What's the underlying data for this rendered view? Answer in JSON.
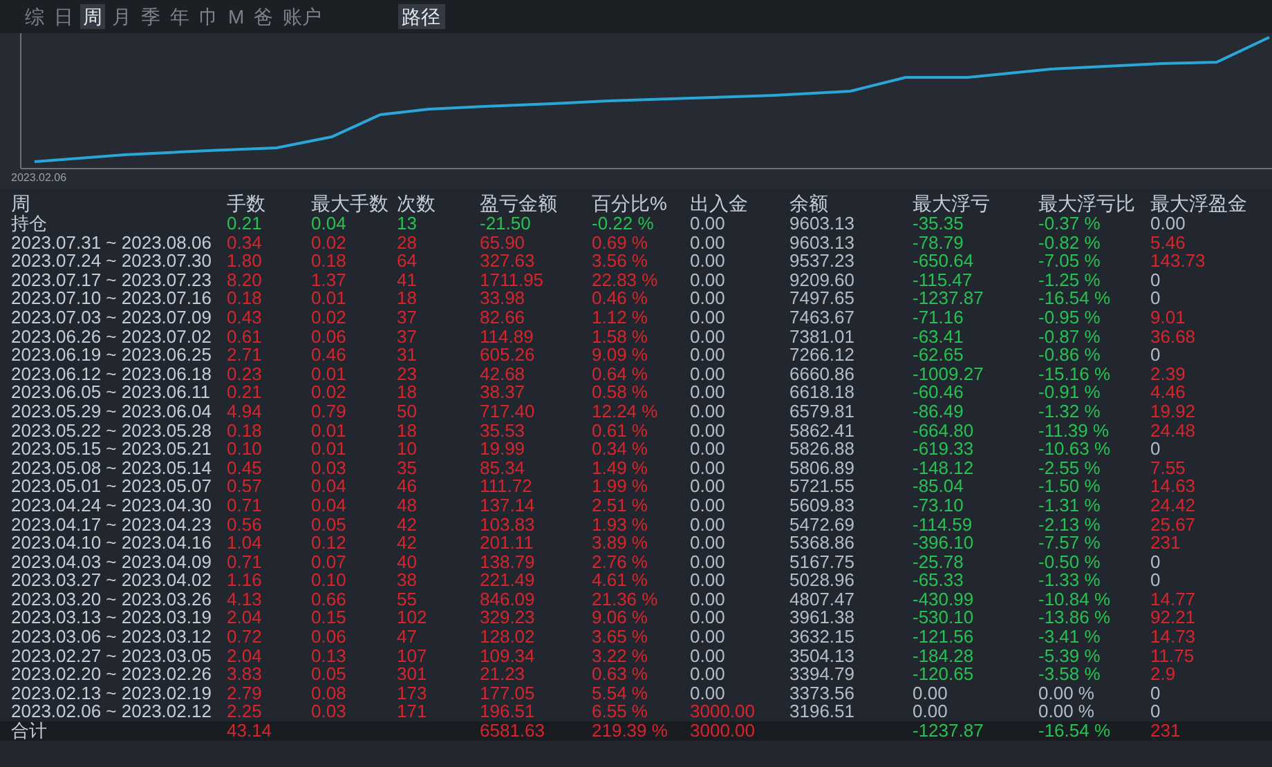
{
  "tabs": [
    {
      "label": "综",
      "selected": false
    },
    {
      "label": "日",
      "selected": false
    },
    {
      "label": "周",
      "selected": true
    },
    {
      "label": "月",
      "selected": false
    },
    {
      "label": "季",
      "selected": false
    },
    {
      "label": "年",
      "selected": false
    },
    {
      "label": "巾",
      "selected": false
    },
    {
      "label": "M",
      "selected": false
    },
    {
      "label": "爸",
      "selected": false
    },
    {
      "label": "账户",
      "selected": false
    }
  ],
  "path_button": {
    "label": "路径",
    "selected": true
  },
  "equity_chart": {
    "start_label": "2023.02.06"
  },
  "table": {
    "period_column": "周",
    "columns": [
      "手数",
      "最大手数",
      "次数",
      "盈亏金额",
      "百分比%",
      "出入金",
      "余额",
      "最大浮亏",
      "最大浮亏比",
      "最大浮盈金"
    ],
    "rows": [
      {
        "period": "持仓",
        "cells": [
          {
            "text": "0.21",
            "color": "#25c24f"
          },
          {
            "text": "0.04",
            "color": "#25c24f"
          },
          {
            "text": "13",
            "color": "#25c24f"
          },
          {
            "text": "-21.50",
            "color": "#25c24f"
          },
          {
            "text": "-0.22 %",
            "color": "#25c24f"
          },
          {
            "text": "0.00",
            "color": "#b4bcc8"
          },
          {
            "text": "9603.13",
            "color": "#b4bcc8"
          },
          {
            "text": "-35.35",
            "color": "#25c24f"
          },
          {
            "text": "-0.37 %",
            "color": "#25c24f"
          },
          {
            "text": "0.00",
            "color": "#b4bcc8"
          }
        ]
      },
      {
        "period": "2023.07.31 ~ 2023.08.06",
        "cells": [
          {
            "text": "0.34",
            "color": "#d8242a"
          },
          {
            "text": "0.02",
            "color": "#d8242a"
          },
          {
            "text": "28",
            "color": "#d8242a"
          },
          {
            "text": "65.90",
            "color": "#d8242a"
          },
          {
            "text": "0.69 %",
            "color": "#d8242a"
          },
          {
            "text": "0.00",
            "color": "#b4bcc8"
          },
          {
            "text": "9603.13",
            "color": "#b4bcc8"
          },
          {
            "text": "-78.79",
            "color": "#25c24f"
          },
          {
            "text": "-0.82 %",
            "color": "#25c24f"
          },
          {
            "text": "5.46",
            "color": "#d8242a"
          }
        ]
      },
      {
        "period": "2023.07.24 ~ 2023.07.30",
        "cells": [
          {
            "text": "1.80",
            "color": "#d8242a"
          },
          {
            "text": "0.18",
            "color": "#d8242a"
          },
          {
            "text": "64",
            "color": "#d8242a"
          },
          {
            "text": "327.63",
            "color": "#d8242a"
          },
          {
            "text": "3.56 %",
            "color": "#d8242a"
          },
          {
            "text": "0.00",
            "color": "#b4bcc8"
          },
          {
            "text": "9537.23",
            "color": "#b4bcc8"
          },
          {
            "text": "-650.64",
            "color": "#25c24f"
          },
          {
            "text": "-7.05 %",
            "color": "#25c24f"
          },
          {
            "text": "143.73",
            "color": "#d8242a"
          }
        ]
      },
      {
        "period": "2023.07.17 ~ 2023.07.23",
        "cells": [
          {
            "text": "8.20",
            "color": "#d8242a"
          },
          {
            "text": "1.37",
            "color": "#d8242a"
          },
          {
            "text": "41",
            "color": "#d8242a"
          },
          {
            "text": "1711.95",
            "color": "#d8242a"
          },
          {
            "text": "22.83 %",
            "color": "#d8242a"
          },
          {
            "text": "0.00",
            "color": "#b4bcc8"
          },
          {
            "text": "9209.60",
            "color": "#b4bcc8"
          },
          {
            "text": "-115.47",
            "color": "#25c24f"
          },
          {
            "text": "-1.25 %",
            "color": "#25c24f"
          },
          {
            "text": "0",
            "color": "#b4bcc8"
          }
        ]
      },
      {
        "period": "2023.07.10 ~ 2023.07.16",
        "cells": [
          {
            "text": "0.18",
            "color": "#d8242a"
          },
          {
            "text": "0.01",
            "color": "#d8242a"
          },
          {
            "text": "18",
            "color": "#d8242a"
          },
          {
            "text": "33.98",
            "color": "#d8242a"
          },
          {
            "text": "0.46 %",
            "color": "#d8242a"
          },
          {
            "text": "0.00",
            "color": "#b4bcc8"
          },
          {
            "text": "7497.65",
            "color": "#b4bcc8"
          },
          {
            "text": "-1237.87",
            "color": "#25c24f"
          },
          {
            "text": "-16.54 %",
            "color": "#25c24f"
          },
          {
            "text": "0",
            "color": "#b4bcc8"
          }
        ]
      },
      {
        "period": "2023.07.03 ~ 2023.07.09",
        "cells": [
          {
            "text": "0.43",
            "color": "#d8242a"
          },
          {
            "text": "0.02",
            "color": "#d8242a"
          },
          {
            "text": "37",
            "color": "#d8242a"
          },
          {
            "text": "82.66",
            "color": "#d8242a"
          },
          {
            "text": "1.12 %",
            "color": "#d8242a"
          },
          {
            "text": "0.00",
            "color": "#b4bcc8"
          },
          {
            "text": "7463.67",
            "color": "#b4bcc8"
          },
          {
            "text": "-71.16",
            "color": "#25c24f"
          },
          {
            "text": "-0.95 %",
            "color": "#25c24f"
          },
          {
            "text": "9.01",
            "color": "#d8242a"
          }
        ]
      },
      {
        "period": "2023.06.26 ~ 2023.07.02",
        "cells": [
          {
            "text": "0.61",
            "color": "#d8242a"
          },
          {
            "text": "0.06",
            "color": "#d8242a"
          },
          {
            "text": "37",
            "color": "#d8242a"
          },
          {
            "text": "114.89",
            "color": "#d8242a"
          },
          {
            "text": "1.58 %",
            "color": "#d8242a"
          },
          {
            "text": "0.00",
            "color": "#b4bcc8"
          },
          {
            "text": "7381.01",
            "color": "#b4bcc8"
          },
          {
            "text": "-63.41",
            "color": "#25c24f"
          },
          {
            "text": "-0.87 %",
            "color": "#25c24f"
          },
          {
            "text": "36.68",
            "color": "#d8242a"
          }
        ]
      },
      {
        "period": "2023.06.19 ~ 2023.06.25",
        "cells": [
          {
            "text": "2.71",
            "color": "#d8242a"
          },
          {
            "text": "0.46",
            "color": "#d8242a"
          },
          {
            "text": "31",
            "color": "#d8242a"
          },
          {
            "text": "605.26",
            "color": "#d8242a"
          },
          {
            "text": "9.09 %",
            "color": "#d8242a"
          },
          {
            "text": "0.00",
            "color": "#b4bcc8"
          },
          {
            "text": "7266.12",
            "color": "#b4bcc8"
          },
          {
            "text": "-62.65",
            "color": "#25c24f"
          },
          {
            "text": "-0.86 %",
            "color": "#25c24f"
          },
          {
            "text": "0",
            "color": "#b4bcc8"
          }
        ]
      },
      {
        "period": "2023.06.12 ~ 2023.06.18",
        "cells": [
          {
            "text": "0.23",
            "color": "#d8242a"
          },
          {
            "text": "0.01",
            "color": "#d8242a"
          },
          {
            "text": "23",
            "color": "#d8242a"
          },
          {
            "text": "42.68",
            "color": "#d8242a"
          },
          {
            "text": "0.64 %",
            "color": "#d8242a"
          },
          {
            "text": "0.00",
            "color": "#b4bcc8"
          },
          {
            "text": "6660.86",
            "color": "#b4bcc8"
          },
          {
            "text": "-1009.27",
            "color": "#25c24f"
          },
          {
            "text": "-15.16 %",
            "color": "#25c24f"
          },
          {
            "text": "2.39",
            "color": "#d8242a"
          }
        ]
      },
      {
        "period": "2023.06.05 ~ 2023.06.11",
        "cells": [
          {
            "text": "0.21",
            "color": "#d8242a"
          },
          {
            "text": "0.02",
            "color": "#d8242a"
          },
          {
            "text": "18",
            "color": "#d8242a"
          },
          {
            "text": "38.37",
            "color": "#d8242a"
          },
          {
            "text": "0.58 %",
            "color": "#d8242a"
          },
          {
            "text": "0.00",
            "color": "#b4bcc8"
          },
          {
            "text": "6618.18",
            "color": "#b4bcc8"
          },
          {
            "text": "-60.46",
            "color": "#25c24f"
          },
          {
            "text": "-0.91 %",
            "color": "#25c24f"
          },
          {
            "text": "4.46",
            "color": "#d8242a"
          }
        ]
      },
      {
        "period": "2023.05.29 ~ 2023.06.04",
        "cells": [
          {
            "text": "4.94",
            "color": "#d8242a"
          },
          {
            "text": "0.79",
            "color": "#d8242a"
          },
          {
            "text": "50",
            "color": "#d8242a"
          },
          {
            "text": "717.40",
            "color": "#d8242a"
          },
          {
            "text": "12.24 %",
            "color": "#d8242a"
          },
          {
            "text": "0.00",
            "color": "#b4bcc8"
          },
          {
            "text": "6579.81",
            "color": "#b4bcc8"
          },
          {
            "text": "-86.49",
            "color": "#25c24f"
          },
          {
            "text": "-1.32 %",
            "color": "#25c24f"
          },
          {
            "text": "19.92",
            "color": "#d8242a"
          }
        ]
      },
      {
        "period": "2023.05.22 ~ 2023.05.28",
        "cells": [
          {
            "text": "0.18",
            "color": "#d8242a"
          },
          {
            "text": "0.01",
            "color": "#d8242a"
          },
          {
            "text": "18",
            "color": "#d8242a"
          },
          {
            "text": "35.53",
            "color": "#d8242a"
          },
          {
            "text": "0.61 %",
            "color": "#d8242a"
          },
          {
            "text": "0.00",
            "color": "#b4bcc8"
          },
          {
            "text": "5862.41",
            "color": "#b4bcc8"
          },
          {
            "text": "-664.80",
            "color": "#25c24f"
          },
          {
            "text": "-11.39 %",
            "color": "#25c24f"
          },
          {
            "text": "24.48",
            "color": "#d8242a"
          }
        ]
      },
      {
        "period": "2023.05.15 ~ 2023.05.21",
        "cells": [
          {
            "text": "0.10",
            "color": "#d8242a"
          },
          {
            "text": "0.01",
            "color": "#d8242a"
          },
          {
            "text": "10",
            "color": "#d8242a"
          },
          {
            "text": "19.99",
            "color": "#d8242a"
          },
          {
            "text": "0.34 %",
            "color": "#d8242a"
          },
          {
            "text": "0.00",
            "color": "#b4bcc8"
          },
          {
            "text": "5826.88",
            "color": "#b4bcc8"
          },
          {
            "text": "-619.33",
            "color": "#25c24f"
          },
          {
            "text": "-10.63 %",
            "color": "#25c24f"
          },
          {
            "text": "0",
            "color": "#b4bcc8"
          }
        ]
      },
      {
        "period": "2023.05.08 ~ 2023.05.14",
        "cells": [
          {
            "text": "0.45",
            "color": "#d8242a"
          },
          {
            "text": "0.03",
            "color": "#d8242a"
          },
          {
            "text": "35",
            "color": "#d8242a"
          },
          {
            "text": "85.34",
            "color": "#d8242a"
          },
          {
            "text": "1.49 %",
            "color": "#d8242a"
          },
          {
            "text": "0.00",
            "color": "#b4bcc8"
          },
          {
            "text": "5806.89",
            "color": "#b4bcc8"
          },
          {
            "text": "-148.12",
            "color": "#25c24f"
          },
          {
            "text": "-2.55 %",
            "color": "#25c24f"
          },
          {
            "text": "7.55",
            "color": "#d8242a"
          }
        ]
      },
      {
        "period": "2023.05.01 ~ 2023.05.07",
        "cells": [
          {
            "text": "0.57",
            "color": "#d8242a"
          },
          {
            "text": "0.04",
            "color": "#d8242a"
          },
          {
            "text": "46",
            "color": "#d8242a"
          },
          {
            "text": "111.72",
            "color": "#d8242a"
          },
          {
            "text": "1.99 %",
            "color": "#d8242a"
          },
          {
            "text": "0.00",
            "color": "#b4bcc8"
          },
          {
            "text": "5721.55",
            "color": "#b4bcc8"
          },
          {
            "text": "-85.04",
            "color": "#25c24f"
          },
          {
            "text": "-1.50 %",
            "color": "#25c24f"
          },
          {
            "text": "14.63",
            "color": "#d8242a"
          }
        ]
      },
      {
        "period": "2023.04.24 ~ 2023.04.30",
        "cells": [
          {
            "text": "0.71",
            "color": "#d8242a"
          },
          {
            "text": "0.04",
            "color": "#d8242a"
          },
          {
            "text": "48",
            "color": "#d8242a"
          },
          {
            "text": "137.14",
            "color": "#d8242a"
          },
          {
            "text": "2.51 %",
            "color": "#d8242a"
          },
          {
            "text": "0.00",
            "color": "#b4bcc8"
          },
          {
            "text": "5609.83",
            "color": "#b4bcc8"
          },
          {
            "text": "-73.10",
            "color": "#25c24f"
          },
          {
            "text": "-1.31 %",
            "color": "#25c24f"
          },
          {
            "text": "24.42",
            "color": "#d8242a"
          }
        ]
      },
      {
        "period": "2023.04.17 ~ 2023.04.23",
        "cells": [
          {
            "text": "0.56",
            "color": "#d8242a"
          },
          {
            "text": "0.05",
            "color": "#d8242a"
          },
          {
            "text": "42",
            "color": "#d8242a"
          },
          {
            "text": "103.83",
            "color": "#d8242a"
          },
          {
            "text": "1.93 %",
            "color": "#d8242a"
          },
          {
            "text": "0.00",
            "color": "#b4bcc8"
          },
          {
            "text": "5472.69",
            "color": "#b4bcc8"
          },
          {
            "text": "-114.59",
            "color": "#25c24f"
          },
          {
            "text": "-2.13 %",
            "color": "#25c24f"
          },
          {
            "text": "25.67",
            "color": "#d8242a"
          }
        ]
      },
      {
        "period": "2023.04.10 ~ 2023.04.16",
        "cells": [
          {
            "text": "1.04",
            "color": "#d8242a"
          },
          {
            "text": "0.12",
            "color": "#d8242a"
          },
          {
            "text": "42",
            "color": "#d8242a"
          },
          {
            "text": "201.11",
            "color": "#d8242a"
          },
          {
            "text": "3.89 %",
            "color": "#d8242a"
          },
          {
            "text": "0.00",
            "color": "#b4bcc8"
          },
          {
            "text": "5368.86",
            "color": "#b4bcc8"
          },
          {
            "text": "-396.10",
            "color": "#25c24f"
          },
          {
            "text": "-7.57 %",
            "color": "#25c24f"
          },
          {
            "text": "231",
            "color": "#d8242a"
          }
        ]
      },
      {
        "period": "2023.04.03 ~ 2023.04.09",
        "cells": [
          {
            "text": "0.71",
            "color": "#d8242a"
          },
          {
            "text": "0.07",
            "color": "#d8242a"
          },
          {
            "text": "40",
            "color": "#d8242a"
          },
          {
            "text": "138.79",
            "color": "#d8242a"
          },
          {
            "text": "2.76 %",
            "color": "#d8242a"
          },
          {
            "text": "0.00",
            "color": "#b4bcc8"
          },
          {
            "text": "5167.75",
            "color": "#b4bcc8"
          },
          {
            "text": "-25.78",
            "color": "#25c24f"
          },
          {
            "text": "-0.50 %",
            "color": "#25c24f"
          },
          {
            "text": "0",
            "color": "#b4bcc8"
          }
        ]
      },
      {
        "period": "2023.03.27 ~ 2023.04.02",
        "cells": [
          {
            "text": "1.16",
            "color": "#d8242a"
          },
          {
            "text": "0.10",
            "color": "#d8242a"
          },
          {
            "text": "38",
            "color": "#d8242a"
          },
          {
            "text": "221.49",
            "color": "#d8242a"
          },
          {
            "text": "4.61 %",
            "color": "#d8242a"
          },
          {
            "text": "0.00",
            "color": "#b4bcc8"
          },
          {
            "text": "5028.96",
            "color": "#b4bcc8"
          },
          {
            "text": "-65.33",
            "color": "#25c24f"
          },
          {
            "text": "-1.33 %",
            "color": "#25c24f"
          },
          {
            "text": "0",
            "color": "#b4bcc8"
          }
        ]
      },
      {
        "period": "2023.03.20 ~ 2023.03.26",
        "cells": [
          {
            "text": "4.13",
            "color": "#d8242a"
          },
          {
            "text": "0.66",
            "color": "#d8242a"
          },
          {
            "text": "55",
            "color": "#d8242a"
          },
          {
            "text": "846.09",
            "color": "#d8242a"
          },
          {
            "text": "21.36 %",
            "color": "#d8242a"
          },
          {
            "text": "0.00",
            "color": "#b4bcc8"
          },
          {
            "text": "4807.47",
            "color": "#b4bcc8"
          },
          {
            "text": "-430.99",
            "color": "#25c24f"
          },
          {
            "text": "-10.84 %",
            "color": "#25c24f"
          },
          {
            "text": "14.77",
            "color": "#d8242a"
          }
        ]
      },
      {
        "period": "2023.03.13 ~ 2023.03.19",
        "cells": [
          {
            "text": "2.04",
            "color": "#d8242a"
          },
          {
            "text": "0.15",
            "color": "#d8242a"
          },
          {
            "text": "102",
            "color": "#d8242a"
          },
          {
            "text": "329.23",
            "color": "#d8242a"
          },
          {
            "text": "9.06 %",
            "color": "#d8242a"
          },
          {
            "text": "0.00",
            "color": "#b4bcc8"
          },
          {
            "text": "3961.38",
            "color": "#b4bcc8"
          },
          {
            "text": "-530.10",
            "color": "#25c24f"
          },
          {
            "text": "-13.86 %",
            "color": "#25c24f"
          },
          {
            "text": "92.21",
            "color": "#d8242a"
          }
        ]
      },
      {
        "period": "2023.03.06 ~ 2023.03.12",
        "cells": [
          {
            "text": "0.72",
            "color": "#d8242a"
          },
          {
            "text": "0.06",
            "color": "#d8242a"
          },
          {
            "text": "47",
            "color": "#d8242a"
          },
          {
            "text": "128.02",
            "color": "#d8242a"
          },
          {
            "text": "3.65 %",
            "color": "#d8242a"
          },
          {
            "text": "0.00",
            "color": "#b4bcc8"
          },
          {
            "text": "3632.15",
            "color": "#b4bcc8"
          },
          {
            "text": "-121.56",
            "color": "#25c24f"
          },
          {
            "text": "-3.41 %",
            "color": "#25c24f"
          },
          {
            "text": "14.73",
            "color": "#d8242a"
          }
        ]
      },
      {
        "period": "2023.02.27 ~ 2023.03.05",
        "cells": [
          {
            "text": "2.04",
            "color": "#d8242a"
          },
          {
            "text": "0.13",
            "color": "#d8242a"
          },
          {
            "text": "107",
            "color": "#d8242a"
          },
          {
            "text": "109.34",
            "color": "#d8242a"
          },
          {
            "text": "3.22 %",
            "color": "#d8242a"
          },
          {
            "text": "0.00",
            "color": "#b4bcc8"
          },
          {
            "text": "3504.13",
            "color": "#b4bcc8"
          },
          {
            "text": "-184.28",
            "color": "#25c24f"
          },
          {
            "text": "-5.39 %",
            "color": "#25c24f"
          },
          {
            "text": "11.75",
            "color": "#d8242a"
          }
        ]
      },
      {
        "period": "2023.02.20 ~ 2023.02.26",
        "cells": [
          {
            "text": "3.83",
            "color": "#d8242a"
          },
          {
            "text": "0.05",
            "color": "#d8242a"
          },
          {
            "text": "301",
            "color": "#d8242a"
          },
          {
            "text": "21.23",
            "color": "#d8242a"
          },
          {
            "text": "0.63 %",
            "color": "#d8242a"
          },
          {
            "text": "0.00",
            "color": "#b4bcc8"
          },
          {
            "text": "3394.79",
            "color": "#b4bcc8"
          },
          {
            "text": "-120.65",
            "color": "#25c24f"
          },
          {
            "text": "-3.58 %",
            "color": "#25c24f"
          },
          {
            "text": "2.9",
            "color": "#d8242a"
          }
        ]
      },
      {
        "period": "2023.02.13 ~ 2023.02.19",
        "cells": [
          {
            "text": "2.79",
            "color": "#d8242a"
          },
          {
            "text": "0.08",
            "color": "#d8242a"
          },
          {
            "text": "173",
            "color": "#d8242a"
          },
          {
            "text": "177.05",
            "color": "#d8242a"
          },
          {
            "text": "5.54 %",
            "color": "#d8242a"
          },
          {
            "text": "0.00",
            "color": "#b4bcc8"
          },
          {
            "text": "3373.56",
            "color": "#b4bcc8"
          },
          {
            "text": "0.00",
            "color": "#b4bcc8"
          },
          {
            "text": "0.00 %",
            "color": "#b4bcc8"
          },
          {
            "text": "0",
            "color": "#b4bcc8"
          }
        ]
      },
      {
        "period": "2023.02.06 ~ 2023.02.12",
        "cells": [
          {
            "text": "2.25",
            "color": "#d8242a"
          },
          {
            "text": "0.03",
            "color": "#d8242a"
          },
          {
            "text": "171",
            "color": "#d8242a"
          },
          {
            "text": "196.51",
            "color": "#d8242a"
          },
          {
            "text": "6.55 %",
            "color": "#d8242a"
          },
          {
            "text": "3000.00",
            "color": "#d8242a"
          },
          {
            "text": "3196.51",
            "color": "#b4bcc8"
          },
          {
            "text": "0.00",
            "color": "#b4bcc8"
          },
          {
            "text": "0.00 %",
            "color": "#b4bcc8"
          },
          {
            "text": "0",
            "color": "#b4bcc8"
          }
        ]
      }
    ],
    "total": {
      "period": "合计",
      "cells": [
        {
          "text": "43.14",
          "color": "#d8242a"
        },
        null,
        null,
        {
          "text": "6581.63",
          "color": "#d8242a"
        },
        {
          "text": "219.39 %",
          "color": "#d8242a"
        },
        {
          "text": "3000.00",
          "color": "#d8242a"
        },
        null,
        {
          "text": "-1237.87",
          "color": "#25c24f"
        },
        {
          "text": "-16.54 %",
          "color": "#25c24f"
        },
        {
          "text": "231",
          "color": "#d8242a"
        }
      ]
    }
  }
}
